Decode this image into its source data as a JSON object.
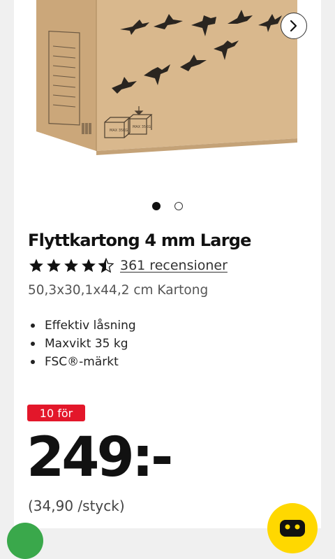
{
  "product": {
    "title": "Flyttkartong 4 mm Large",
    "rating": 4.5,
    "reviews_text": "361 recensioner",
    "dimensions": "50,3x30,1x44,2 cm Kartong",
    "features": [
      "Effektiv låsning",
      "Maxvikt 35 kg",
      "FSC®-märkt"
    ],
    "image_print": [
      "MAX 35KG",
      "MAX 35KG"
    ]
  },
  "carousel": {
    "total": 2,
    "active_index": 0,
    "next_icon": "chevron-right-icon"
  },
  "pricing": {
    "badge": "10 för",
    "price": "249:-",
    "unit_price": "(34,90 /styck)"
  },
  "colors": {
    "badge": "#e3172a",
    "cart_button": "#ffd800",
    "chat_button": "#3aa84b",
    "cardboard": "#d9b88d"
  },
  "icons": {
    "cart": "cart-icon",
    "chat": "chat-icon"
  }
}
